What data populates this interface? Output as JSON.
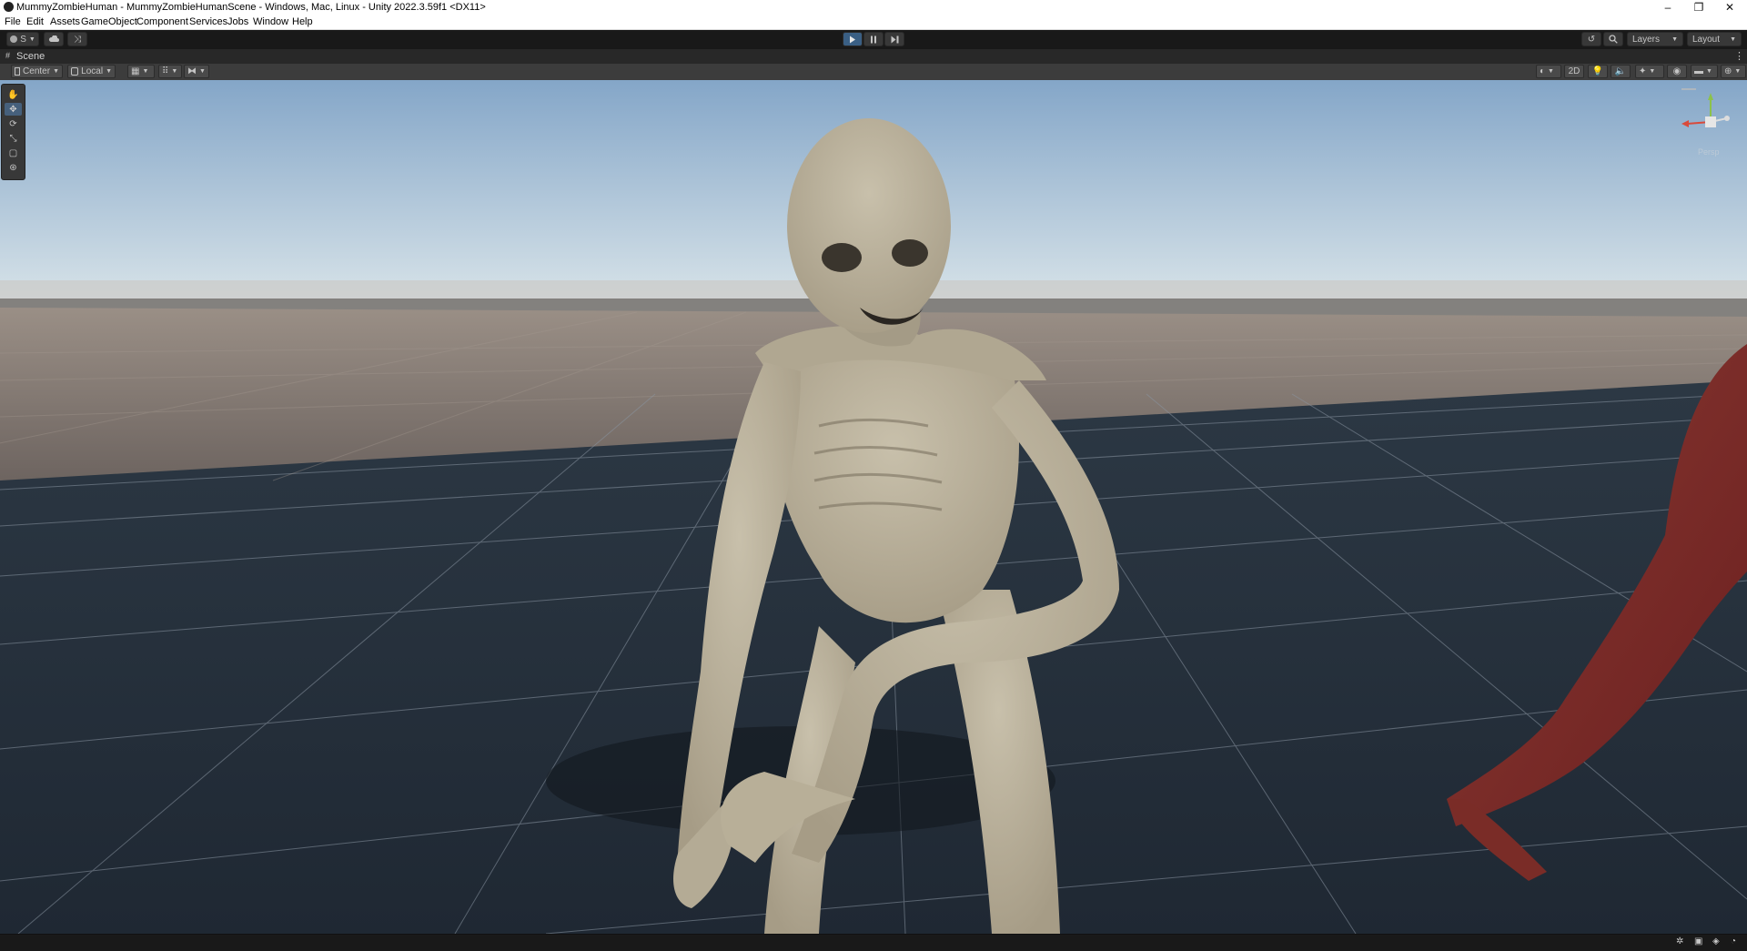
{
  "window": {
    "title": "MummyZombieHuman - MummyZombieHumanScene - Windows, Mac, Linux - Unity 2022.3.59f1 <DX11>",
    "controls": {
      "minimize": "–",
      "restore": "❐",
      "close": "✕"
    }
  },
  "menu": {
    "items": [
      "File",
      "Edit",
      "Assets",
      "GameObject",
      "Component",
      "Services",
      "Jobs",
      "Window",
      "Help"
    ]
  },
  "toolbar": {
    "account_label": "S",
    "layers_label": "Layers",
    "layout_label": "Layout",
    "play_icon": "play-icon",
    "pause_icon": "pause-icon",
    "step_icon": "step-icon"
  },
  "scene_tab": {
    "label": "Scene"
  },
  "scene_toolbar": {
    "pivot_label": "Center",
    "space_label": "Local",
    "mode_2d_label": "2D"
  },
  "gizmo": {
    "label": "Persp"
  },
  "colors": {
    "sky_top": "#84a6c8",
    "sky_horizon": "#d6e2e8",
    "ground_far": "#6b625e",
    "floor": "#1f2833",
    "accent_play": "#3a5f84",
    "mummy_skin": "#a69c86",
    "red_creature": "#6b1f1f"
  }
}
